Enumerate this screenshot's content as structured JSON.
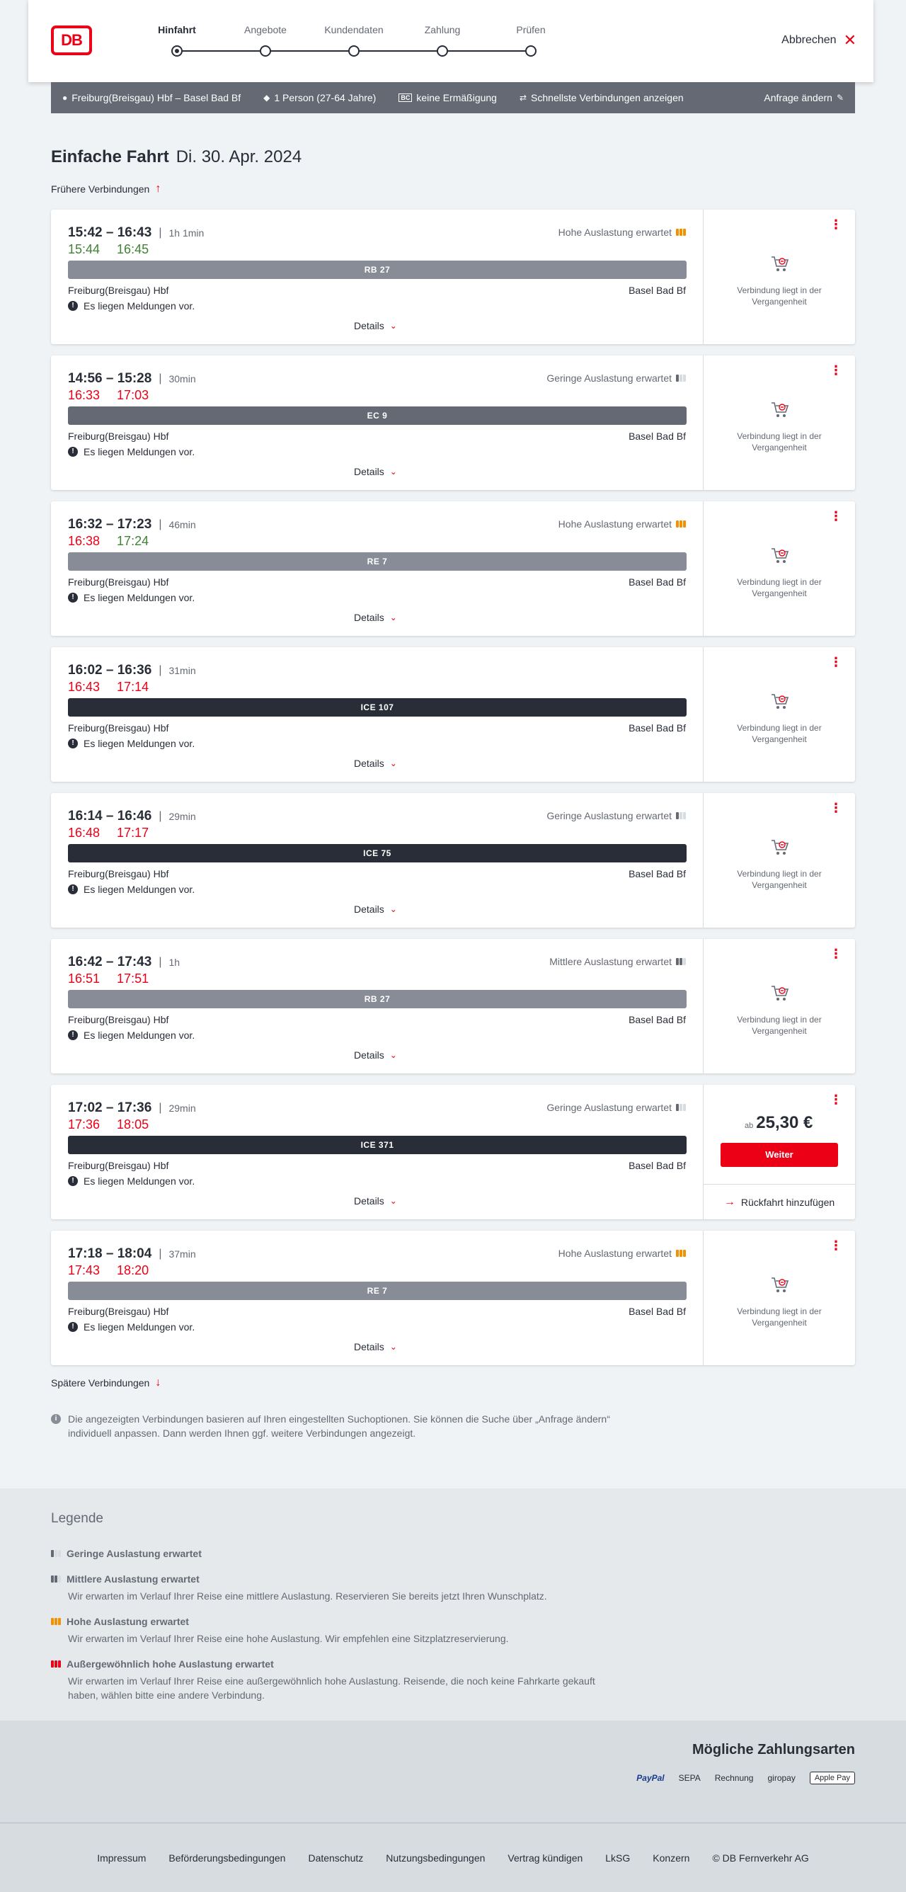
{
  "header": {
    "logo": "DB",
    "steps": [
      {
        "label": "Hinfahrt",
        "active": true
      },
      {
        "label": "Angebote",
        "active": false
      },
      {
        "label": "Kundendaten",
        "active": false
      },
      {
        "label": "Zahlung",
        "active": false
      },
      {
        "label": "Prüfen",
        "active": false
      }
    ],
    "cancel_label": "Abbrechen"
  },
  "search": {
    "route": "Freiburg(Breisgau) Hbf – Basel Bad Bf",
    "persons": "1 Person (27-64 Jahre)",
    "discount_badge": "BC",
    "discount": "keine Ermäßigung",
    "fastest": "Schnellste Verbindungen anzeigen",
    "change": "Anfrage ändern"
  },
  "title": {
    "type": "Einfache Fahrt",
    "date": "Di. 30. Apr. 2024"
  },
  "earlier_label": "Frühere Verbindungen",
  "later_label": "Spätere Verbindungen",
  "connections": [
    {
      "times": "15:42 – 16:43",
      "duration": "1h 1min",
      "rt_dep": "15:44",
      "rt_arr": "16:45",
      "dep_status": "on",
      "arr_status": "on",
      "load": "Hohe Auslastung erwartet",
      "load_level": 3,
      "train": "RB 27",
      "train_kind": "regio",
      "from": "Freiburg(Breisgau) Hbf",
      "to": "Basel Bad Bf",
      "message": "Es liegen Meldungen vor.",
      "details": "Details",
      "past_text": "Verbindung liegt in der Vergangenheit"
    },
    {
      "times": "14:56 – 15:28",
      "duration": "30min",
      "rt_dep": "16:33",
      "rt_arr": "17:03",
      "dep_status": "late",
      "arr_status": "late",
      "load": "Geringe Auslastung erwartet",
      "load_level": 1,
      "train": "EC 9",
      "train_kind": "ec",
      "from": "Freiburg(Breisgau) Hbf",
      "to": "Basel Bad Bf",
      "message": "Es liegen Meldungen vor.",
      "details": "Details",
      "past_text": "Verbindung liegt in der Vergangenheit"
    },
    {
      "times": "16:32 – 17:23",
      "duration": "46min",
      "rt_dep": "16:38",
      "rt_arr": "17:24",
      "dep_status": "late",
      "arr_status": "on",
      "load": "Hohe Auslastung erwartet",
      "load_level": 3,
      "train": "RE 7",
      "train_kind": "regio",
      "from": "Freiburg(Breisgau) Hbf",
      "to": "Basel Bad Bf",
      "message": "Es liegen Meldungen vor.",
      "details": "Details",
      "past_text": "Verbindung liegt in der Vergangenheit"
    },
    {
      "times": "16:02 – 16:36",
      "duration": "31min",
      "rt_dep": "16:43",
      "rt_arr": "17:14",
      "dep_status": "late",
      "arr_status": "late",
      "load": "",
      "load_level": 0,
      "train": "ICE 107",
      "train_kind": "ice",
      "from": "Freiburg(Breisgau) Hbf",
      "to": "Basel Bad Bf",
      "message": "Es liegen Meldungen vor.",
      "details": "Details",
      "past_text": "Verbindung liegt in der Vergangenheit"
    },
    {
      "times": "16:14 – 16:46",
      "duration": "29min",
      "rt_dep": "16:48",
      "rt_arr": "17:17",
      "dep_status": "late",
      "arr_status": "late",
      "load": "Geringe Auslastung erwartet",
      "load_level": 1,
      "train": "ICE 75",
      "train_kind": "ice",
      "from": "Freiburg(Breisgau) Hbf",
      "to": "Basel Bad Bf",
      "message": "Es liegen Meldungen vor.",
      "details": "Details",
      "past_text": "Verbindung liegt in der Vergangenheit"
    },
    {
      "times": "16:42 – 17:43",
      "duration": "1h",
      "rt_dep": "16:51",
      "rt_arr": "17:51",
      "dep_status": "late",
      "arr_status": "late",
      "load": "Mittlere Auslastung erwartet",
      "load_level": 2,
      "train": "RB 27",
      "train_kind": "regio",
      "from": "Freiburg(Breisgau) Hbf",
      "to": "Basel Bad Bf",
      "message": "Es liegen Meldungen vor.",
      "details": "Details",
      "past_text": "Verbindung liegt in der Vergangenheit"
    },
    {
      "times": "17:02 – 17:36",
      "duration": "29min",
      "rt_dep": "17:36",
      "rt_arr": "18:05",
      "dep_status": "late",
      "arr_status": "late",
      "load": "Geringe Auslastung erwartet",
      "load_level": 1,
      "train": "ICE 371",
      "train_kind": "ice",
      "from": "Freiburg(Breisgau) Hbf",
      "to": "Basel Bad Bf",
      "message": "Es liegen Meldungen vor.",
      "details": "Details",
      "bookable": true,
      "price_prefix": "ab",
      "price": "25,30 €",
      "weiter": "Weiter",
      "return_label": "Rückfahrt hinzufügen"
    },
    {
      "times": "17:18 – 18:04",
      "duration": "37min",
      "rt_dep": "17:43",
      "rt_arr": "18:20",
      "dep_status": "late",
      "arr_status": "late",
      "load": "Hohe Auslastung erwartet",
      "load_level": 3,
      "train": "RE 7",
      "train_kind": "regio",
      "from": "Freiburg(Breisgau) Hbf",
      "to": "Basel Bad Bf",
      "message": "Es liegen Meldungen vor.",
      "details": "Details",
      "past_text": "Verbindung liegt in der Vergangenheit"
    }
  ],
  "info_text": "Die angezeigten Verbindungen basieren auf Ihren eingestellten Suchoptionen. Sie können die Suche über „Anfrage ändern“ individuell anpassen. Dann werden Ihnen ggf. weitere Verbindungen angezeigt.",
  "legend": {
    "title": "Legende",
    "items": [
      {
        "title": "Geringe Auslastung erwartet",
        "desc": "",
        "level": 1
      },
      {
        "title": "Mittlere Auslastung erwartet",
        "desc": "Wir erwarten im Verlauf Ihrer Reise eine mittlere Auslastung. Reservieren Sie bereits jetzt Ihren Wunschplatz.",
        "level": 2
      },
      {
        "title": "Hohe Auslastung erwartet",
        "desc": "Wir erwarten im Verlauf Ihrer Reise eine hohe Auslastung. Wir empfehlen eine Sitzplatzreservierung.",
        "level": 3
      },
      {
        "title": "Außergewöhnlich hohe Auslastung erwartet",
        "desc": "Wir erwarten im Verlauf Ihrer Reise eine außergewöhnlich hohe Auslastung. Reisende, die noch keine Fahrkarte gekauft haben, wählen bitte eine andere Verbindung.",
        "level": 4
      }
    ]
  },
  "payments": {
    "title": "Mögliche Zahlungsarten",
    "methods": [
      "PayPal",
      "SEPA",
      "Rechnung",
      "giropay",
      "Apple Pay"
    ]
  },
  "footer": [
    "Impressum",
    "Beförderungsbedingungen",
    "Datenschutz",
    "Nutzungsbedingungen",
    "Vertrag kündigen",
    "LkSG",
    "Konzern",
    "© DB Fernverkehr AG"
  ],
  "colors": {
    "accent": "#ec0016",
    "on_time": "#408335",
    "high_load": "#f39200"
  }
}
